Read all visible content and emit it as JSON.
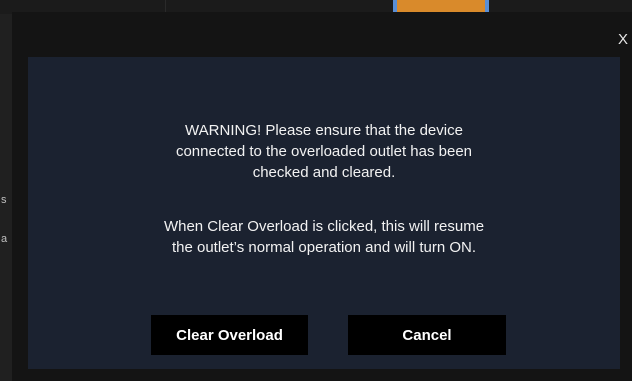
{
  "background": {
    "left_glyphs": [
      "s",
      "a"
    ]
  },
  "dialog": {
    "close_label": "X",
    "warning_lines": [
      "WARNING! Please ensure that the device",
      "connected to the overloaded outlet has been",
      "checked and cleared."
    ],
    "info_lines": [
      "When Clear Overload is clicked, this will resume",
      "the outlet’s normal operation and will turn ON."
    ],
    "buttons": {
      "clear_overload": "Clear Overload",
      "cancel": "Cancel"
    }
  },
  "colors": {
    "panel_bg": "#1b2230",
    "button_bg": "#000000",
    "text": "#f2f2f2"
  }
}
